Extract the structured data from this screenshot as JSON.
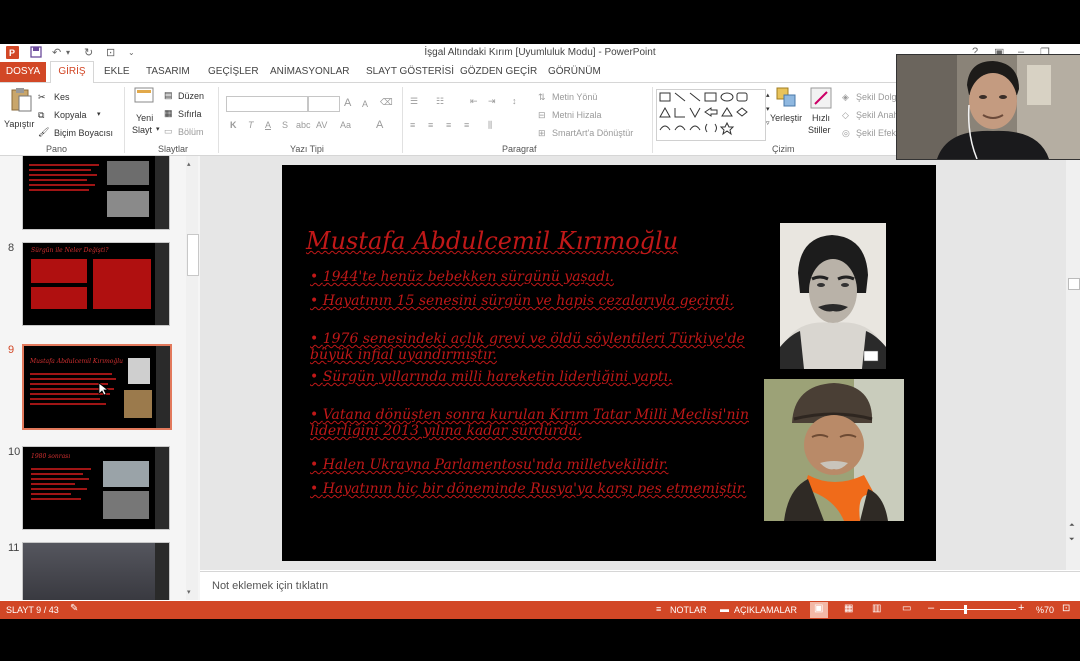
{
  "window": {
    "title": "İşgal Altındaki Kırım [Uyumluluk Modu] - PowerPoint",
    "help": "?"
  },
  "tabs": [
    "DOSYA",
    "GİRİŞ",
    "EKLE",
    "TASARIM",
    "GEÇİŞLER",
    "ANİMASYONLAR",
    "SLAYT GÖSTERİSİ",
    "GÖZDEN GEÇİR",
    "GÖRÜNÜM"
  ],
  "ribbon": {
    "pano": {
      "paste": "Yapıştır",
      "cut": "Kes",
      "copy": "Kopyala",
      "format_painter": "Biçim Boyacısı",
      "group": "Pano"
    },
    "slaytlar": {
      "new_slide_1": "Yeni",
      "new_slide_2": "Slayt",
      "layout": "Düzen",
      "reset": "Sıfırla",
      "section": "Bölüm",
      "group": "Slaytlar"
    },
    "yazi_tipi": {
      "bold": "K",
      "italic": "T",
      "underline": "A",
      "strike": "S",
      "shadow": "abc",
      "spacing": "AV",
      "case": "Aa",
      "color": "A",
      "grow": "A",
      "shrink": "A",
      "group": "Yazı Tipi"
    },
    "paragraf": {
      "text_direction": "Metin Yönü",
      "align_text": "Metni Hizala",
      "smartart": "SmartArt'a Dönüştür",
      "group": "Paragraf"
    },
    "cizim": {
      "arrange": "Yerleştir",
      "quick_styles_1": "Hızlı",
      "quick_styles_2": "Stiller",
      "fill": "Şekil Dolg",
      "outline": "Şekil Anah",
      "effects": "Şekil Efekt",
      "group": "Çizim"
    }
  },
  "thumbnails": [
    {
      "num": "",
      "title": ""
    },
    {
      "num": "8",
      "title": "Sürgün ile Neler Değişti?"
    },
    {
      "num": "9",
      "title": "Mustafa Abdulcemil Kırımoğlu"
    },
    {
      "num": "10",
      "title": "1980 sonrası"
    },
    {
      "num": "11",
      "title": ""
    }
  ],
  "slide": {
    "title": "Mustafa Abdulcemil Kırımoğlu",
    "bullets": [
      "1944'te henüz bebekken sürgünü yaşadı.",
      "Hayatının 15 senesini sürgün ve hapis cezalarıyla geçirdi.",
      "1976 senesindeki açlık grevi ve öldü söylentileri Türkiye'de büyük infial uyandırmıştır.",
      "Sürgün yıllarında milli hareketin liderliğini yaptı.",
      "Vatana dönüşten sonra kurulan Kırım Tatar Milli Meclisi'nin liderliğini 2013 yılına kadar sürdürdü.",
      "Halen Ukrayna Parlamentosu'nda milletvekilidir.",
      "Hayatının hiç bir döneminde Rusya'ya karşı pes etmemiştir."
    ]
  },
  "notes": {
    "placeholder": "Not eklemek için tıklatın"
  },
  "status": {
    "slide_indicator": "SLAYT 9 / 43",
    "notes": "NOTLAR",
    "comments": "AÇIKLAMALAR",
    "zoom": "%70",
    "zoom_level": 0.7
  },
  "colors": {
    "accent": "#d24726",
    "slide_title": "#c01818",
    "slide_bg": "#000000"
  }
}
